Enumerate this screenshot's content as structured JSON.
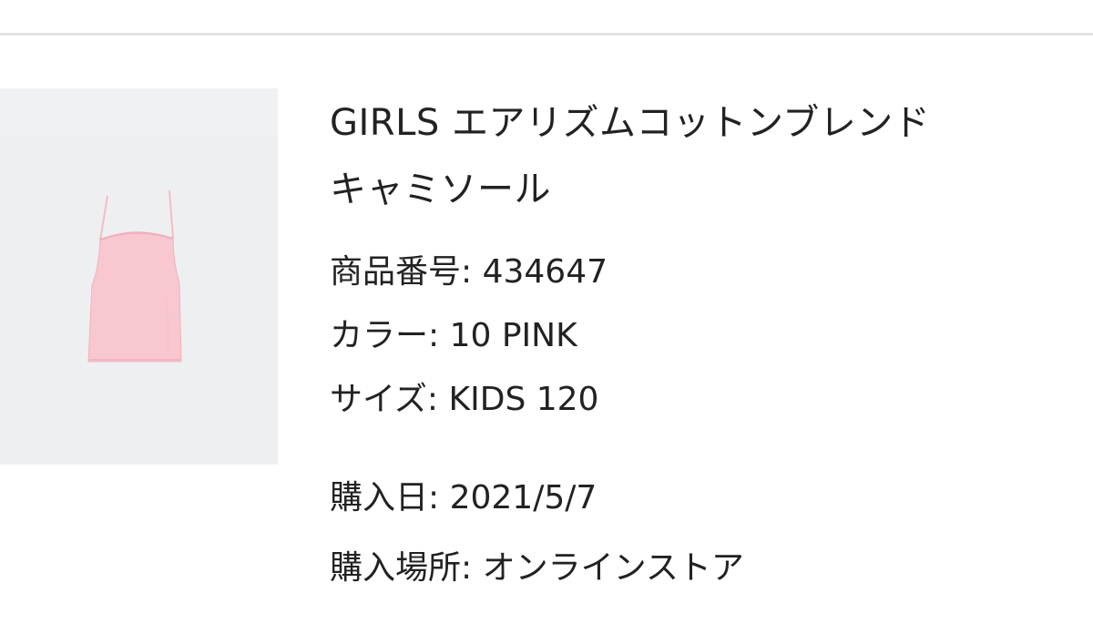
{
  "product": {
    "title_line1": "GIRLS エアリズムコットンブレンド",
    "title_line2": "キャミソール",
    "image": {
      "description_icon": "camisole-image",
      "garment_color": "#f7c6cf",
      "background_color": "#eeeff1"
    }
  },
  "info": {
    "product_number": "商品番号: 434647",
    "color": "カラー: 10 PINK",
    "size": "サイズ: KIDS 120",
    "purchase_date": "購入日: 2021/5/7",
    "purchase_place": "購入場所: オンラインストア"
  }
}
